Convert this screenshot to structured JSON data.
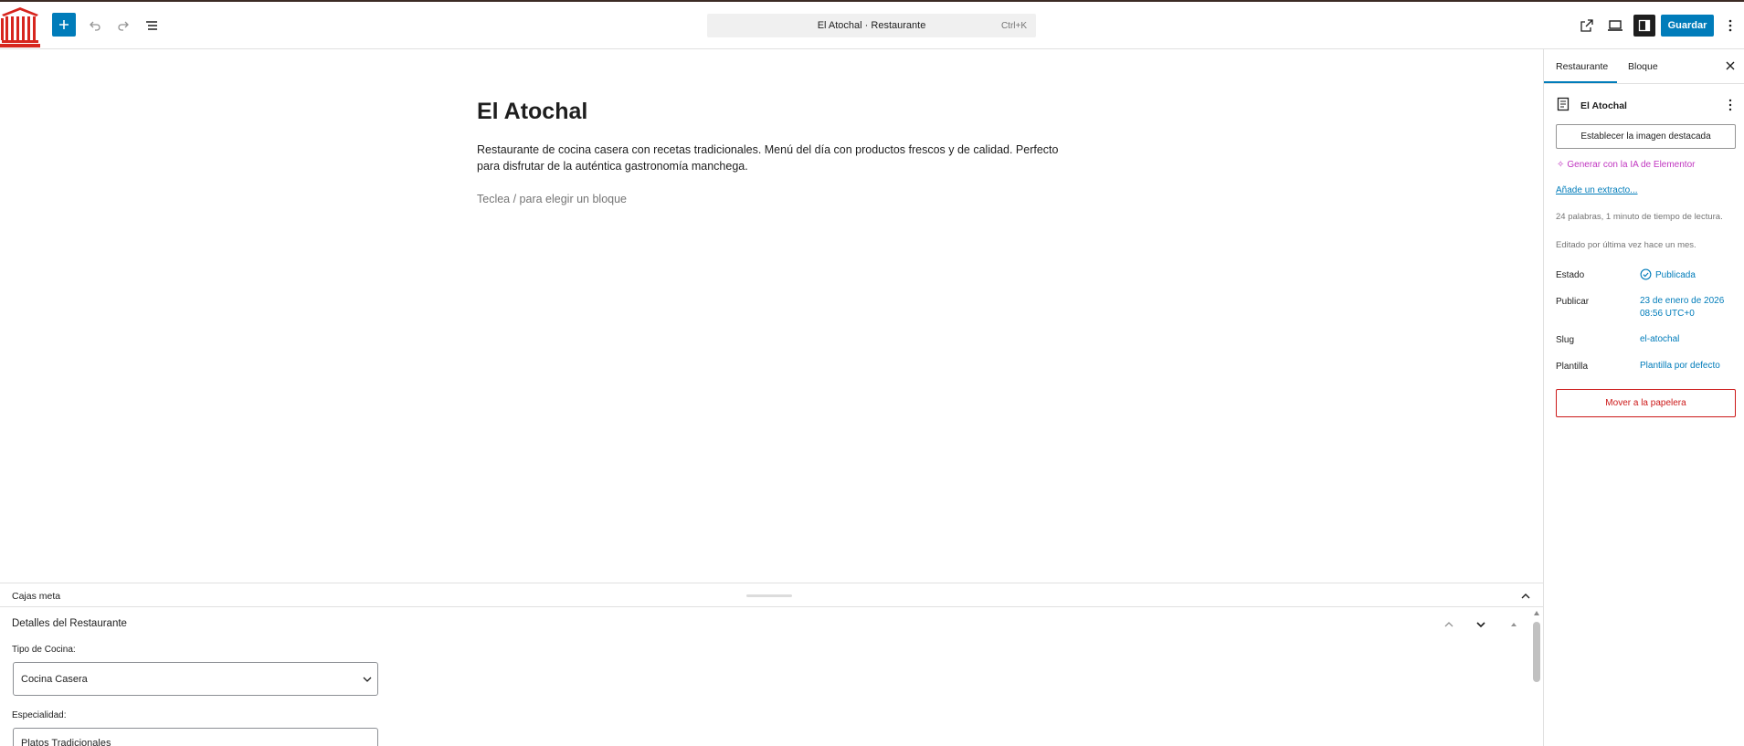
{
  "header": {
    "command_title": "El Atochal · Restaurante",
    "command_shortcut": "Ctrl+K",
    "save_label": "Guardar"
  },
  "editor": {
    "title": "El Atochal",
    "paragraph": "Restaurante de cocina casera con recetas tradicionales. Menú del día con productos frescos y de calidad. Perfecto para disfrutar de la auténtica gastronomía manchega.",
    "block_placeholder": "Teclea / para elegir un bloque"
  },
  "meta_boxes": {
    "label": "Cajas meta",
    "box_title": "Detalles del Restaurante",
    "fields": {
      "tipo_label": "Tipo de Cocina:",
      "tipo_value": "Cocina Casera",
      "especialidad_label": "Especialidad:",
      "especialidad_value": "Platos Tradicionales"
    }
  },
  "sidebar": {
    "tabs": {
      "doc": "Restaurante",
      "block": "Bloque"
    },
    "doc_name": "El Atochal",
    "featured_image": "Establecer la imagen destacada",
    "ai_link": "Generar con la IA de Elementor",
    "excerpt_link": "Añade un extracto...",
    "stats": "24 palabras, 1 minuto de tiempo de lectura.",
    "edited": "Editado por última vez hace un mes.",
    "rows": {
      "estado_label": "Estado",
      "estado_value": "Publicada",
      "publicar_label": "Publicar",
      "publicar_value_1": "23 de enero de 2026",
      "publicar_value_2": "08:56 UTC+0",
      "slug_label": "Slug",
      "slug_value": "el-atochal",
      "plantilla_label": "Plantilla",
      "plantilla_value": "Plantilla por defecto"
    },
    "trash": "Mover a la papelera"
  },
  "colors": {
    "accent": "#007cba",
    "danger": "#cc1818",
    "ai": "#c036c0",
    "logo": "#d7261e"
  },
  "icons": {
    "logo": "site-logo-building-icon",
    "add": "plus-icon",
    "undo": "undo-icon",
    "redo": "redo-icon",
    "list_view": "list-view-icon",
    "view": "external-link-icon",
    "preview": "desktop-preview-icon",
    "settings": "sidebar-settings-icon",
    "options": "vertical-ellipsis-icon"
  }
}
